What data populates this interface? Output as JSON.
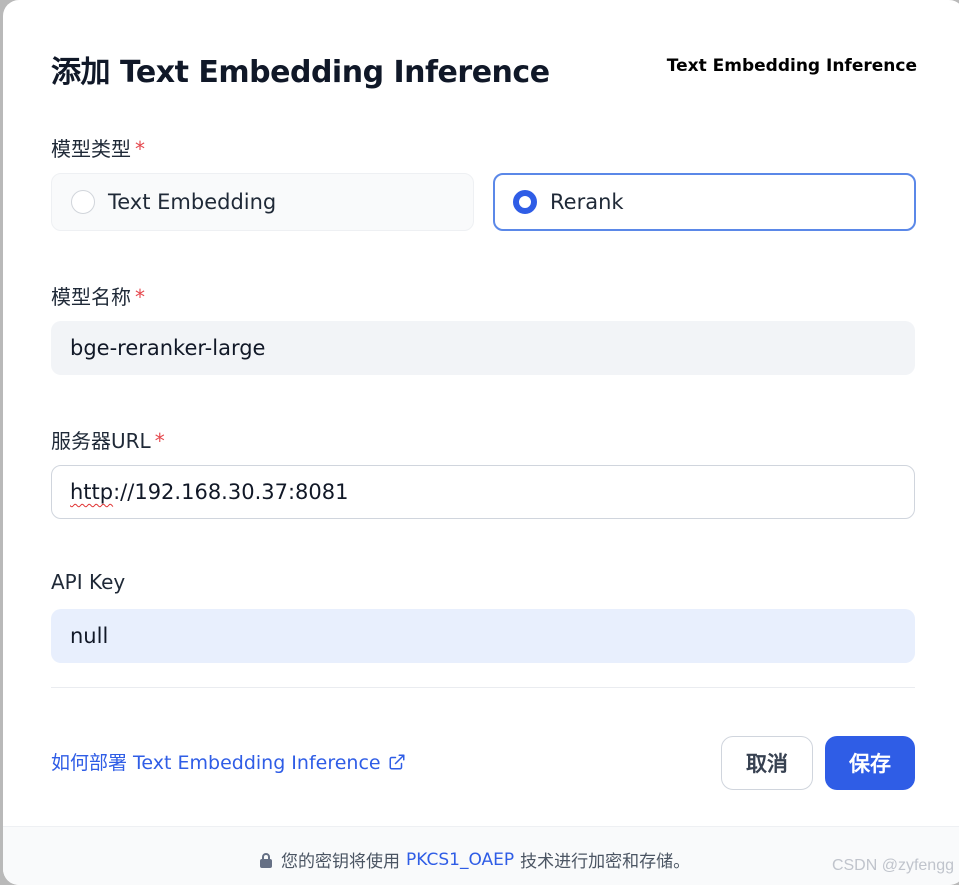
{
  "dialog": {
    "title": "添加 Text Embedding Inference",
    "provider": "Text Embedding Inference"
  },
  "model_type": {
    "label": "模型类型",
    "required_mark": "*",
    "options": [
      {
        "label": "Text Embedding",
        "selected": false
      },
      {
        "label": "Rerank",
        "selected": true
      }
    ]
  },
  "model_name": {
    "label": "模型名称",
    "required_mark": "*",
    "value": "bge-reranker-large"
  },
  "server_url": {
    "label": "服务器URL",
    "required_mark": "*",
    "value_prefix": "http",
    "value_rest": "://192.168.30.37:8081"
  },
  "api_key": {
    "label": "API Key",
    "value": "null"
  },
  "actions": {
    "doc_link": "如何部署 Text Embedding Inference",
    "cancel": "取消",
    "save": "保存"
  },
  "footer": {
    "prefix": "您的密钥将使用",
    "link": "PKCS1_OAEP",
    "suffix": "技术进行加密和存储。"
  },
  "watermark": "CSDN @zyfengg",
  "colors": {
    "primary": "#2f5de6",
    "required": "#e5484d",
    "selected_border": "#5b88e8"
  },
  "icons": {
    "doc_link": "external-link-icon",
    "footer": "lock-icon"
  }
}
